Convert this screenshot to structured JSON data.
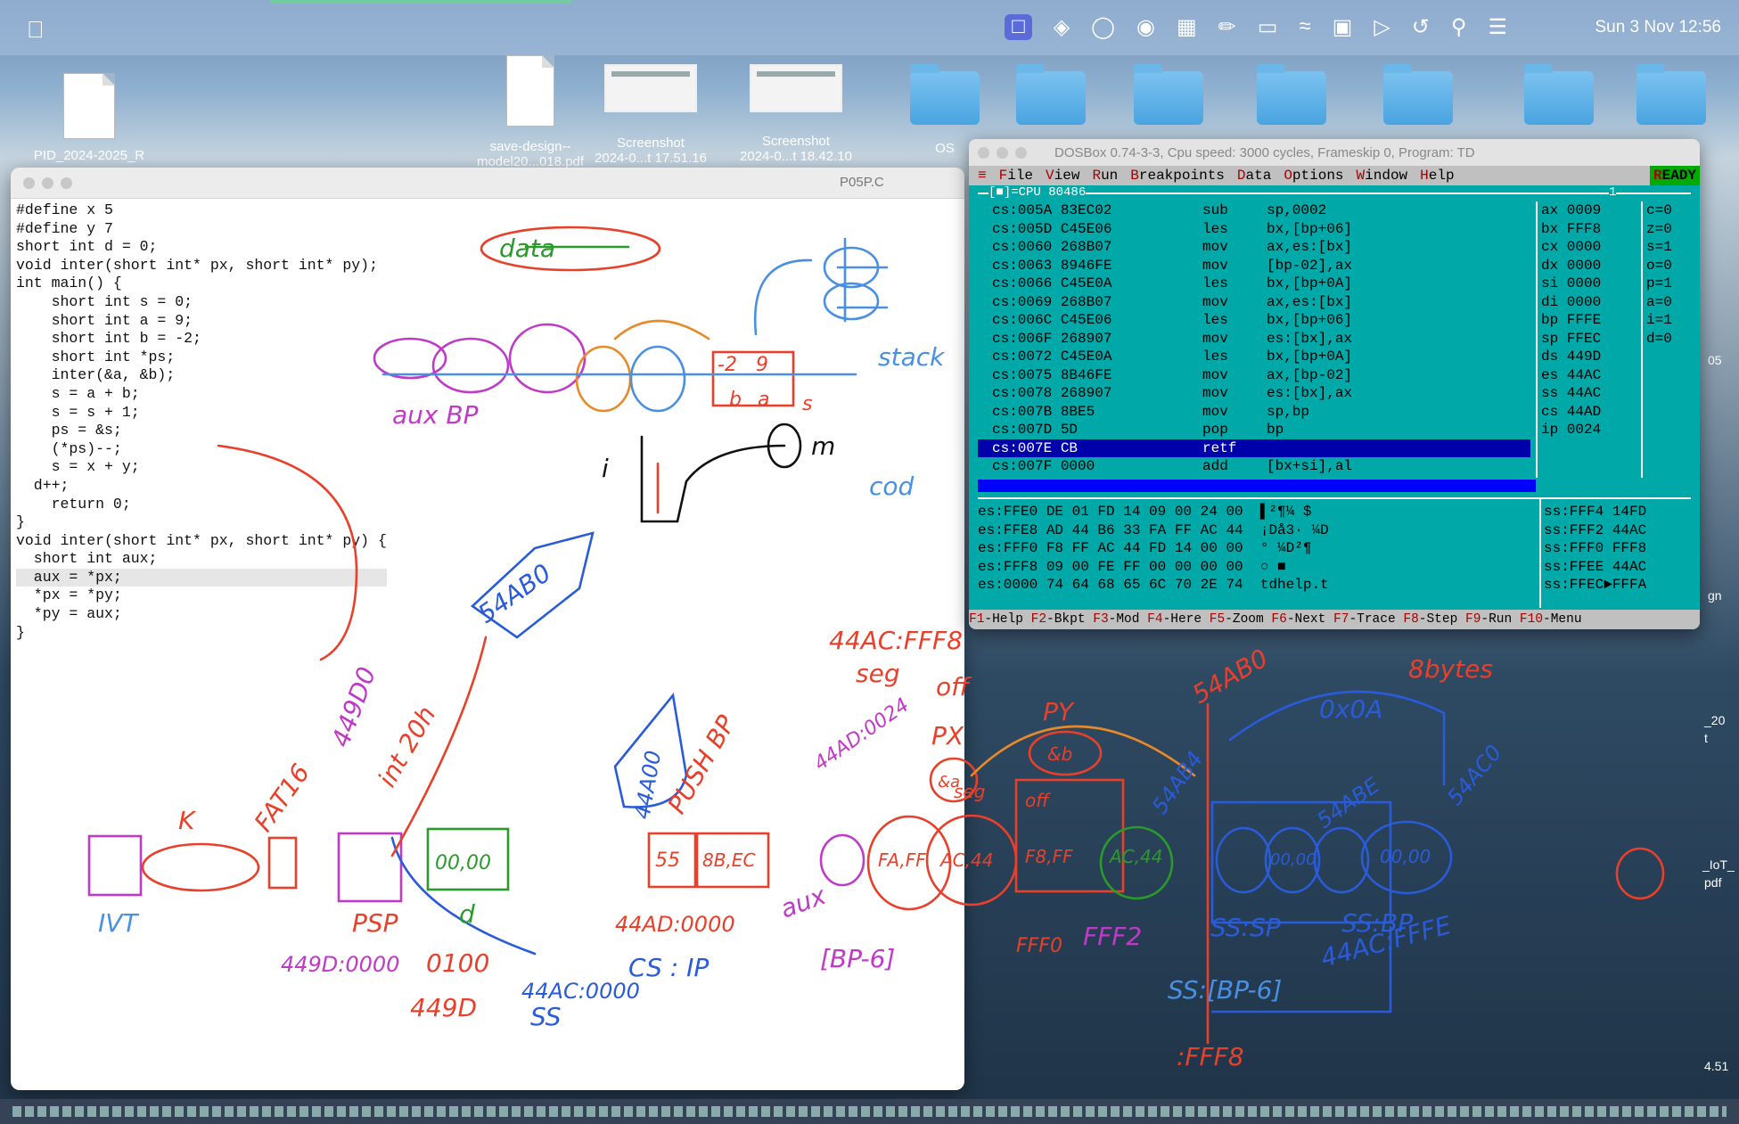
{
  "menubar": {
    "clock": "Sun 3 Nov  12:56",
    "icons": [
      "apple-icon",
      "screen-share-icon",
      "binoculars-icon",
      "creative-cloud-icon",
      "globe-icon",
      "translate-icon",
      "pen-icon",
      "battery-icon",
      "wifi-icon",
      "qz-icon",
      "play-icon",
      "history-icon",
      "search-icon",
      "control-center-icon"
    ]
  },
  "desktop": {
    "items": [
      {
        "label": "PID_2024-2025_R",
        "kind": "doc"
      },
      {
        "label": "save-design--\nmodel20...018.pdf",
        "kind": "pdf"
      },
      {
        "label": "Screenshot\n2024-0...t 17.51.16",
        "kind": "shot"
      },
      {
        "label": "Screenshot\n2024-0...t 18.42.10",
        "kind": "shot"
      },
      {
        "label": "OS",
        "kind": "folder"
      }
    ],
    "right_labels": [
      "05",
      "gn",
      "_20",
      "t",
      "_IoT_",
      "pdf",
      "4.51"
    ]
  },
  "editor": {
    "filename": "P05P.C",
    "code": [
      "#define x 5",
      "#define y 7",
      "",
      "short int d = 0;",
      "",
      "void inter(short int* px, short int* py);",
      "",
      "int main() {",
      "    short int s = 0;",
      "    short int a = 9;",
      "    short int b = -2;",
      "    short int *ps;",
      "",
      "    inter(&a, &b);",
      "",
      "    s = a + b;",
      "    s = s + 1;",
      "    ps = &s;",
      "    (*ps)--;",
      "    s = x + y;",
      "  d++;",
      "",
      "    return 0;",
      "}",
      "",
      "void inter(short int* px, short int* py) {",
      "  short int aux;",
      "  aux = *px;",
      "  *px = *py;",
      "  *py = aux;",
      "}"
    ]
  },
  "dosbox": {
    "title": "DOSBox 0.74-3-3, Cpu speed:   3000 cycles, Frameskip  0, Program:    TD",
    "menu": [
      "File",
      "View",
      "Run",
      "Breakpoints",
      "Data",
      "Options",
      "Window",
      "Help"
    ],
    "ready": "READY",
    "cpu_label": "[■]=CPU 80486",
    "pane_number": "1",
    "asm": [
      {
        "addr": "cs:005A 83EC02",
        "mn": "sub",
        "op": "sp,0002"
      },
      {
        "addr": "cs:005D C45E06",
        "mn": "les",
        "op": "bx,[bp+06]"
      },
      {
        "addr": "cs:0060 268B07",
        "mn": "mov",
        "op": "ax,es:[bx]"
      },
      {
        "addr": "cs:0063 8946FE",
        "mn": "mov",
        "op": "[bp-02],ax"
      },
      {
        "addr": "cs:0066 C45E0A",
        "mn": "les",
        "op": "bx,[bp+0A]"
      },
      {
        "addr": "cs:0069 268B07",
        "mn": "mov",
        "op": "ax,es:[bx]"
      },
      {
        "addr": "cs:006C C45E06",
        "mn": "les",
        "op": "bx,[bp+06]"
      },
      {
        "addr": "cs:006F 268907",
        "mn": "mov",
        "op": "es:[bx],ax"
      },
      {
        "addr": "cs:0072 C45E0A",
        "mn": "les",
        "op": "bx,[bp+0A]"
      },
      {
        "addr": "cs:0075 8B46FE",
        "mn": "mov",
        "op": "ax,[bp-02]"
      },
      {
        "addr": "cs:0078 268907",
        "mn": "mov",
        "op": "es:[bx],ax"
      },
      {
        "addr": "cs:007B 8BE5",
        "mn": "mov",
        "op": "sp,bp"
      },
      {
        "addr": "cs:007D 5D",
        "mn": "pop",
        "op": "bp"
      },
      {
        "addr": "cs:007E CB",
        "mn": "retf",
        "op": ""
      },
      {
        "addr": "cs:007F 0000",
        "mn": "add",
        "op": "[bx+si],al"
      }
    ],
    "selected_row": 13,
    "registers": [
      "ax 0009",
      "bx FFF8",
      "cx 0000",
      "dx 0000",
      "si 0000",
      "di 0000",
      "bp FFFE",
      "sp FFEC",
      "ds 449D",
      "es 44AC",
      "ss 44AC",
      "cs 44AD",
      "ip 0024"
    ],
    "flags": [
      "c=0",
      "z=0",
      "s=1",
      "o=0",
      "p=1",
      "a=0",
      "i=1",
      "d=0"
    ],
    "dump": [
      "es:FFE0 DE 01 FD 14 09 00 24 00  ▌²¶¼ $",
      "es:FFE8 AD 44 B6 33 FA FF AC 44  ¡Då3· ¼D",
      "es:FFF0 F8 FF AC 44 FD 14 00 00  ° ¼D²¶",
      "es:FFF8 09 00 FE FF 00 00 00 00  ○ ■",
      "es:0000 74 64 68 65 6C 70 2E 74  tdhelp.t"
    ],
    "stack": [
      "ss:FFF4 14FD",
      "ss:FFF2 44AC",
      "ss:FFF0 FFF8",
      "ss:FFEE 44AC",
      "ss:FFEC►FFFA"
    ],
    "fkeys": [
      {
        "k": "F1",
        "t": "-Help "
      },
      {
        "k": "F2",
        "t": "-Bkpt "
      },
      {
        "k": "F3",
        "t": "-Mod "
      },
      {
        "k": "F4",
        "t": "-Here "
      },
      {
        "k": "F5",
        "t": "-Zoom "
      },
      {
        "k": "F6",
        "t": "-Next "
      },
      {
        "k": "F7",
        "t": "-Trace "
      },
      {
        "k": "F8",
        "t": "-Step "
      },
      {
        "k": "F9",
        "t": "-Run "
      },
      {
        "k": "F10",
        "t": "-Menu"
      }
    ]
  },
  "annotations": {
    "texts": [
      {
        "t": "data",
        "c": "#2a9a2a"
      },
      {
        "t": "stack",
        "c": "#4a90e2"
      },
      {
        "t": "aux BP",
        "c": "#c03ac8"
      },
      {
        "t": "cod",
        "c": "#4a90e2"
      },
      {
        "t": "m",
        "c": "#111"
      },
      {
        "t": "i",
        "c": "#111"
      },
      {
        "t": "54AB0",
        "c": "#2a5bd8"
      },
      {
        "t": "44AC:FFF8",
        "c": "#e8402a"
      },
      {
        "t": "seg",
        "c": "#e8402a"
      },
      {
        "t": "off",
        "c": "#e8402a"
      },
      {
        "t": "54AB0",
        "c": "#e8402a"
      },
      {
        "t": "8bytes",
        "c": "#e8402a"
      },
      {
        "t": "0x0A",
        "c": "#2a5bd8"
      },
      {
        "t": "44AD:0024",
        "c": "#c03ac8"
      },
      {
        "t": "PUSH BP",
        "c": "#e8402a"
      },
      {
        "t": "44A00",
        "c": "#2a5bd8"
      },
      {
        "t": "int 20h",
        "c": "#e8402a"
      },
      {
        "t": "449D0",
        "c": "#c03ac8"
      },
      {
        "t": "FAT16",
        "c": "#e8402a"
      },
      {
        "t": "K",
        "c": "#e8402a"
      },
      {
        "t": "IVT",
        "c": "#4a90e2"
      },
      {
        "t": "PSP",
        "c": "#e8402a"
      },
      {
        "t": "449D:0000",
        "c": "#c03ac8"
      },
      {
        "t": "0100",
        "c": "#e8402a"
      },
      {
        "t": "449D",
        "c": "#e8402a"
      },
      {
        "t": "44AC:0000",
        "c": "#2a5bd8"
      },
      {
        "t": "SS",
        "c": "#2a5bd8"
      },
      {
        "t": "44AD:0000",
        "c": "#e8402a"
      },
      {
        "t": "CS : IP",
        "c": "#2a5bd8"
      },
      {
        "t": "aux",
        "c": "#c03ac8"
      },
      {
        "t": "[BP-6]",
        "c": "#c03ac8"
      },
      {
        "t": "PX",
        "c": "#e8402a"
      },
      {
        "t": "PY",
        "c": "#e8402a"
      },
      {
        "t": "FFF2",
        "c": "#c03ac8"
      },
      {
        "t": "FFF0",
        "c": "#e8402a"
      },
      {
        "t": "SS:SP",
        "c": "#2a5bd8"
      },
      {
        "t": "SS:BP",
        "c": "#2a5bd8"
      },
      {
        "t": "44AC:FFFE",
        "c": "#2a5bd8"
      },
      {
        "t": "SS:[BP-6]",
        "c": "#4a90e2"
      },
      {
        "t": ":FFF8",
        "c": "#e8402a"
      },
      {
        "t": "54AB4",
        "c": "#2a5bd8"
      },
      {
        "t": "54ABE",
        "c": "#2a5bd8"
      },
      {
        "t": "54AC0",
        "c": "#2a5bd8"
      },
      {
        "t": "00,00",
        "c": "#2a9a2a"
      },
      {
        "t": "d",
        "c": "#2a9a2a"
      },
      {
        "t": "55",
        "c": "#e8402a"
      },
      {
        "t": "8B,EC",
        "c": "#e8402a"
      },
      {
        "t": "FA,FF",
        "c": "#e8402a"
      },
      {
        "t": "AC,44",
        "c": "#e8402a"
      },
      {
        "t": "F8,FF",
        "c": "#e8402a"
      },
      {
        "t": "AC,44",
        "c": "#2a9a2a"
      },
      {
        "t": "&b",
        "c": "#e8402a"
      },
      {
        "t": "&a",
        "c": "#e8402a"
      },
      {
        "t": "seg",
        "c": "#e8402a"
      },
      {
        "t": "off",
        "c": "#e8402a"
      },
      {
        "t": "00,00",
        "c": "#2a5bd8"
      },
      {
        "t": "00,00",
        "c": "#2a5bd8"
      },
      {
        "t": "-2",
        "c": "#e8402a"
      },
      {
        "t": "9",
        "c": "#e8402a"
      },
      {
        "t": "a",
        "c": "#e8402a"
      },
      {
        "t": "s",
        "c": "#e8402a"
      },
      {
        "t": "b",
        "c": "#e8402a"
      }
    ]
  }
}
